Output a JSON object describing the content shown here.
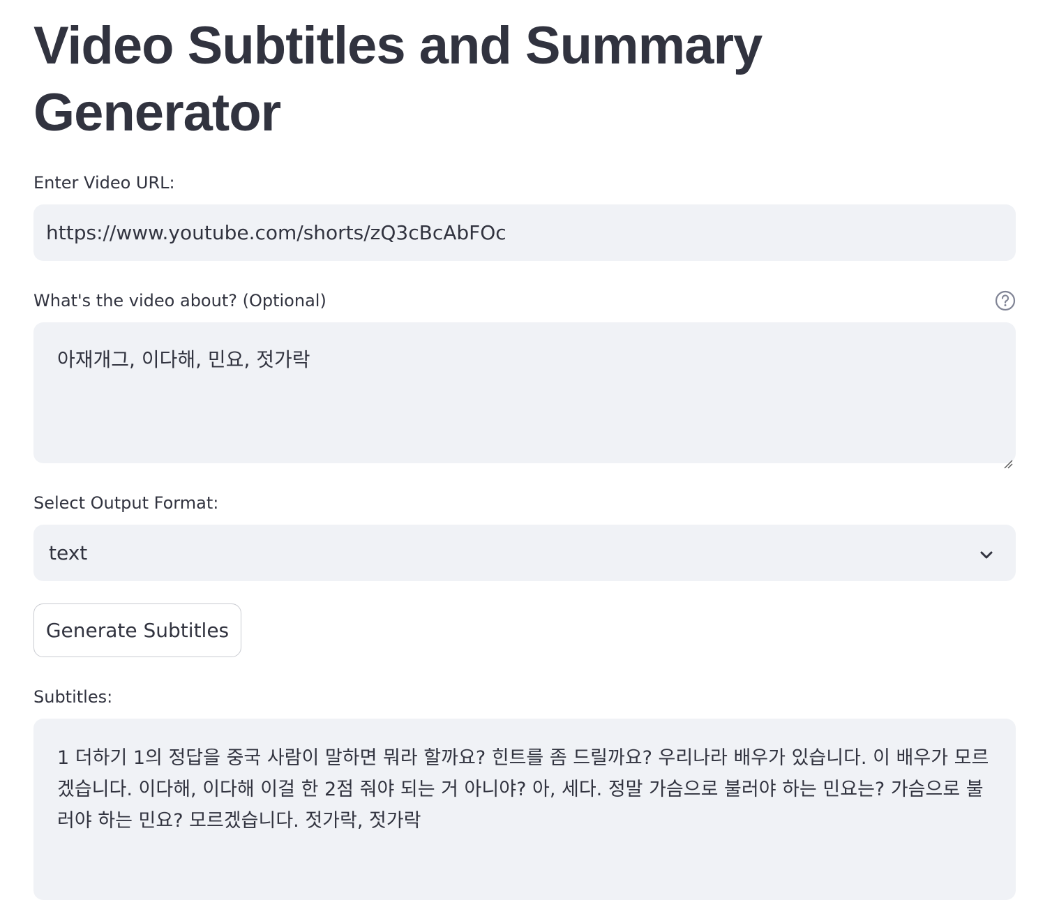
{
  "page": {
    "title": "Video Subtitles and Summary Generator"
  },
  "url_field": {
    "label": "Enter Video URL:",
    "value": "https://www.youtube.com/shorts/zQ3cBcAbFOc"
  },
  "about_field": {
    "label": "What's the video about? (Optional)",
    "value": "아재개그, 이다해, 민요, 젓가락",
    "help_icon": "question-circle-icon"
  },
  "format_select": {
    "label": "Select Output Format:",
    "selected": "text",
    "icon": "chevron-down-icon"
  },
  "generate_button": {
    "label": "Generate Subtitles"
  },
  "subtitles": {
    "label": "Subtitles:",
    "text": "1 더하기 1의 정답을 중국 사람이 말하면 뭐라 할까요? 힌트를 좀 드릴까요? 우리나라 배우가 있습니다. 이 배우가 모르겠습니다. 이다해, 이다해 이걸 한 2점 줘야 되는 거 아니야? 아, 세다. 정말 가슴으로 불러야 하는 민요는? 가슴으로 불러야 하는 민요? 모르겠습니다. 젓가락, 젓가락"
  }
}
